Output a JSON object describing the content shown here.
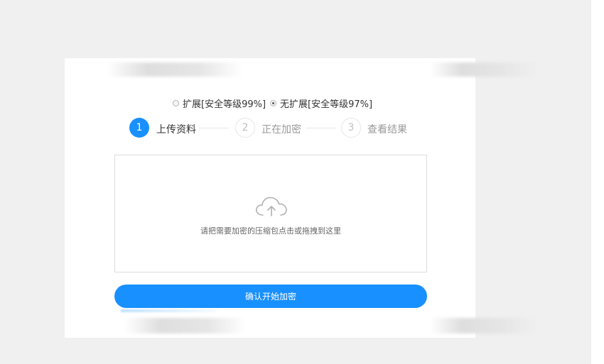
{
  "mode_options": [
    {
      "label": "扩展[安全等级99%]",
      "checked": false
    },
    {
      "label": "无扩展[安全等级97%]",
      "checked": true
    }
  ],
  "steps": [
    {
      "number": "1",
      "label": "上传资料",
      "active": true
    },
    {
      "number": "2",
      "label": "正在加密",
      "active": false
    },
    {
      "number": "3",
      "label": "查看结果",
      "active": false
    }
  ],
  "upload": {
    "icon": "cloud-upload-icon",
    "hint": "请把需要加密的压缩包点击或拖拽到这里"
  },
  "confirm_label": "确认开始加密",
  "colors": {
    "accent": "#1890ff",
    "border": "#dcdcdc",
    "backdrop": "#f0f0f0"
  }
}
